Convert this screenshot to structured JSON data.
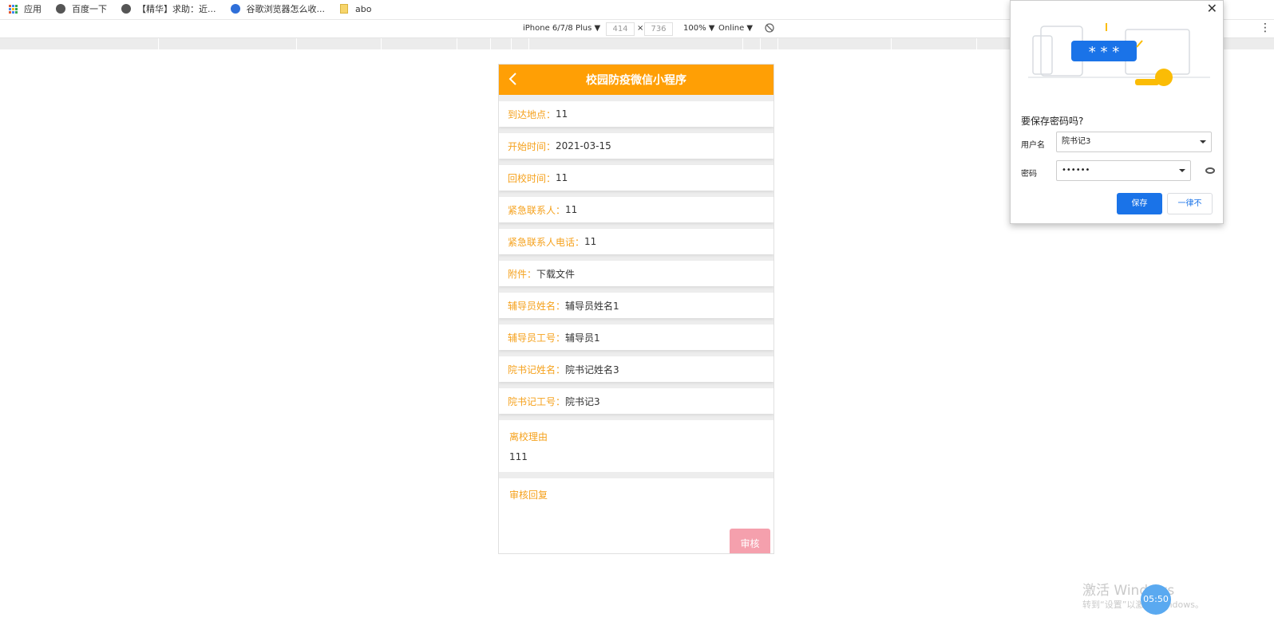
{
  "bookmarks": [
    {
      "label": "应用",
      "icon": "apps-grid-icon"
    },
    {
      "label": "百度一下",
      "icon": "globe-icon"
    },
    {
      "label": "【精华】求助：近...",
      "icon": "globe-icon"
    },
    {
      "label": "谷歌浏览器怎么收...",
      "icon": "baidu-paw-icon"
    },
    {
      "label": "abo",
      "icon": "folder-icon"
    }
  ],
  "devtools": {
    "device": "iPhone 6/7/8 Plus ▼",
    "width": "414",
    "times": "×",
    "height": "736",
    "zoom": "100% ▼",
    "network": "Online ▼"
  },
  "app": {
    "title": "校园防疫微信小程序",
    "back_icon": "chevron-left-icon",
    "fields": [
      {
        "key": "到达地点：",
        "value": "11"
      },
      {
        "key": "开始时间：",
        "value": "2021-03-15"
      },
      {
        "key": "回校时间：",
        "value": "11"
      },
      {
        "key": "紧急联系人：",
        "value": "11"
      },
      {
        "key": "紧急联系人电话：",
        "value": "11"
      },
      {
        "key": "附件：",
        "value": "下载文件"
      },
      {
        "key": "辅导员姓名：",
        "value": "辅导员姓名1"
      },
      {
        "key": "辅导员工号：",
        "value": "辅导员1"
      },
      {
        "key": "院书记姓名：",
        "value": "院书记姓名3"
      },
      {
        "key": "院书记工号：",
        "value": "院书记3"
      }
    ],
    "reason_label": "离校理由",
    "reason_value": "111",
    "reply_label": "审核回复",
    "audit_button": "审核",
    "accent_color": "#ff9f05"
  },
  "password_popup": {
    "title": "要保存密码吗?",
    "username_label": "用户名",
    "username_value": "院书记3",
    "password_label": "密码",
    "password_value": "••••••",
    "save_button": "保存",
    "never_button": "一律不",
    "close_icon": "close-icon",
    "illustration_masked": "* * *"
  },
  "watermark": {
    "line1": "激活 Windows",
    "line2": "转到“设置”以激活 Windows。",
    "clock": "05:50"
  }
}
